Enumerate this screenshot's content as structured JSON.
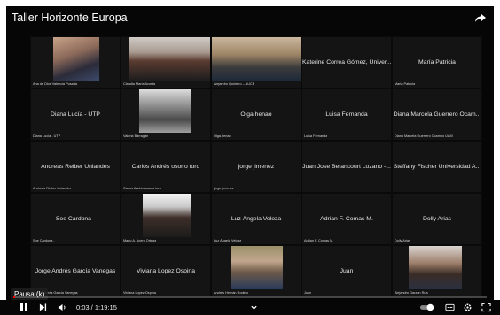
{
  "player": {
    "title": "Taller Horizonte Europa",
    "hover_label": "Pausa (k)",
    "time": "0:03 / 1:19:15",
    "progress_fraction": 0.0006,
    "icons": [
      "share-icon",
      "pause-icon",
      "next-icon",
      "volume-icon",
      "chevron-down-icon",
      "autoplay-toggle",
      "subtitles-icon",
      "settings-icon",
      "fullscreen-icon"
    ]
  },
  "tiles": [
    {
      "center": "",
      "label": "Ana de Dios Valencia Posada",
      "photo": "baby"
    },
    {
      "center": "",
      "label": "Claudia María Acosta",
      "photo": "woman"
    },
    {
      "center": "",
      "label": "Alejandro Quintero – AUCE",
      "photo": "man1"
    },
    {
      "center": "Katerine Correa Gómez, Univer...",
      "label": ""
    },
    {
      "center": "María Patricia",
      "label": "Maria Patricia"
    },
    {
      "center": "Diana Lucía - UTP",
      "label": "Diana Lucía - UTP"
    },
    {
      "center": "",
      "label": "Valeria Barragán",
      "photo": "bw"
    },
    {
      "center": "Olga.henao",
      "label": "Olga.henao"
    },
    {
      "center": "Luisa Fernanda",
      "label": "Luisa Fernanda"
    },
    {
      "center": "Diana Marcela Guerrero Ocam...",
      "label": "Diana Marcela Guerrero Ocampo UAM"
    },
    {
      "center": "Andreas Reiber Uniandes",
      "label": "Andreas Reiber Uniandes"
    },
    {
      "center": "Carlos Andrés osorio toro",
      "label": "Carlos Andrés osorio toro"
    },
    {
      "center": "jorge jimenez",
      "label": "jorge jimenez"
    },
    {
      "center": "Juan Jose Betancourt Lozano -...",
      "label": ""
    },
    {
      "center": "Steffany Fischer Universidad A...",
      "label": ""
    },
    {
      "center": "Soe Cardona -",
      "label": "Soe Cardona -"
    },
    {
      "center": "",
      "label": "Mario A. Acero Ortega",
      "photo": "man2"
    },
    {
      "center": "Luz Ángela Veloza",
      "label": "Luz Ángela Veloza"
    },
    {
      "center": "Adrian F. Comas M.",
      "label": "Adrian F. Comas M."
    },
    {
      "center": "Dolly Arias",
      "label": "Dolly Arias"
    },
    {
      "center": "Jorge Andrés García Vanegas",
      "label": "Jorge Andrés García Vanegas"
    },
    {
      "center": "Viviana Lopez Ospina",
      "label": "Viviana Lopez Ospina"
    },
    {
      "center": "",
      "label": "Andrés Hernán Rodero",
      "photo": "man3"
    },
    {
      "center": "Juan",
      "label": "Juan"
    },
    {
      "center": "",
      "label": "Alejandro Garzón Rua",
      "photo": "man4"
    }
  ]
}
